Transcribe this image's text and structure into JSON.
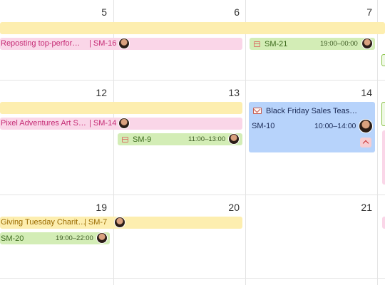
{
  "weeks": [
    {
      "days": [
        "5",
        "6",
        "7"
      ]
    },
    {
      "days": [
        "12",
        "13",
        "14"
      ]
    },
    {
      "days": [
        "19",
        "20",
        "21"
      ]
    }
  ],
  "events": {
    "week1_allday": {
      "color": "#fdeeaf"
    },
    "reposting": {
      "title": "Reposting top-perfor…",
      "key": "| SM-16",
      "color": "#fad6e8"
    },
    "sm21": {
      "key": "SM-21",
      "time": "19:00–00:00",
      "color": "#d3edb6"
    },
    "week2_allday": {
      "color": "#fdeeaf"
    },
    "pixel": {
      "title": "Pixel Adventures Art S…",
      "key": "| SM-14",
      "color": "#fad6e8"
    },
    "sm9": {
      "key": "SM-9",
      "time": "11:00–13:00",
      "color": "#d3edb6"
    },
    "blackfriday": {
      "title": "Black Friday Sales Teas…",
      "key": "SM-10",
      "time": "10:00–14:00",
      "color": "#b7d3fb"
    },
    "giving": {
      "title": "Giving Tuesday Charit…",
      "key": "| SM-7",
      "color": "#fdeeaf"
    },
    "sm20": {
      "key": "SM-20",
      "time": "19:00–22:00",
      "color": "#d3edb6"
    }
  },
  "icons": {
    "avatar": "assignee-avatar-icon",
    "calendar": "calendar-icon",
    "mail": "mail-icon",
    "collapse": "chevron-up-icon"
  }
}
